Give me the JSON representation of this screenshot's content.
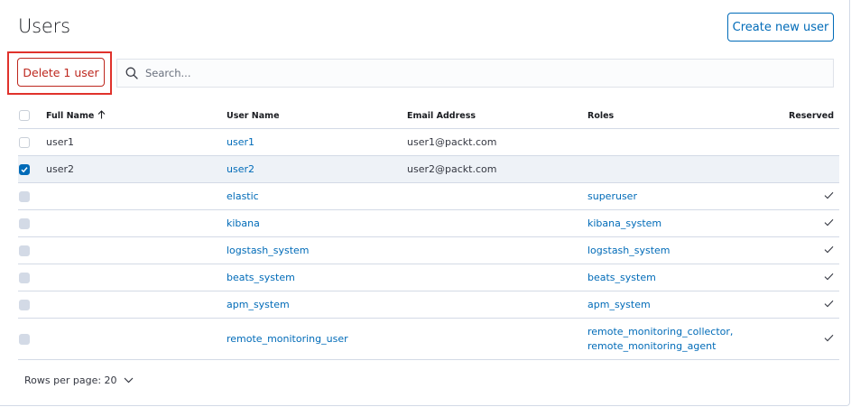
{
  "header": {
    "title": "Users",
    "create_label": "Create new user"
  },
  "toolbar": {
    "delete_label": "Delete 1 user",
    "search_placeholder": "Search..."
  },
  "table": {
    "columns": {
      "full_name": "Full Name",
      "user_name": "User Name",
      "email": "Email Address",
      "roles": "Roles",
      "reserved": "Reserved"
    },
    "sort": {
      "column": "Full Name",
      "direction": "ascending"
    },
    "rows": [
      {
        "full_name": "user1",
        "user_name": "user1",
        "email": "user1@packt.com",
        "roles": [],
        "reserved": false,
        "selected": false,
        "selectable": true
      },
      {
        "full_name": "user2",
        "user_name": "user2",
        "email": "user2@packt.com",
        "roles": [],
        "reserved": false,
        "selected": true,
        "selectable": true
      },
      {
        "full_name": "",
        "user_name": "elastic",
        "email": "",
        "roles": [
          "superuser"
        ],
        "reserved": true,
        "selected": false,
        "selectable": false
      },
      {
        "full_name": "",
        "user_name": "kibana",
        "email": "",
        "roles": [
          "kibana_system"
        ],
        "reserved": true,
        "selected": false,
        "selectable": false
      },
      {
        "full_name": "",
        "user_name": "logstash_system",
        "email": "",
        "roles": [
          "logstash_system"
        ],
        "reserved": true,
        "selected": false,
        "selectable": false
      },
      {
        "full_name": "",
        "user_name": "beats_system",
        "email": "",
        "roles": [
          "beats_system"
        ],
        "reserved": true,
        "selected": false,
        "selectable": false
      },
      {
        "full_name": "",
        "user_name": "apm_system",
        "email": "",
        "roles": [
          "apm_system"
        ],
        "reserved": true,
        "selected": false,
        "selectable": false
      },
      {
        "full_name": "",
        "user_name": "remote_monitoring_user",
        "email": "",
        "roles": [
          "remote_monitoring_collector,",
          "remote_monitoring_agent"
        ],
        "reserved": true,
        "selected": false,
        "selectable": false
      }
    ]
  },
  "pagination": {
    "rows_per_page_label": "Rows per page: 20"
  },
  "colors": {
    "primary": "#006bb8",
    "danger": "#bd271e",
    "highlight_box": "#e0322c",
    "selected_row": "#eef2f7"
  },
  "icons": {
    "search": "search-icon",
    "sort": "arrow-up-icon",
    "reserved": "check-icon",
    "pager": "chevron-down-icon"
  }
}
